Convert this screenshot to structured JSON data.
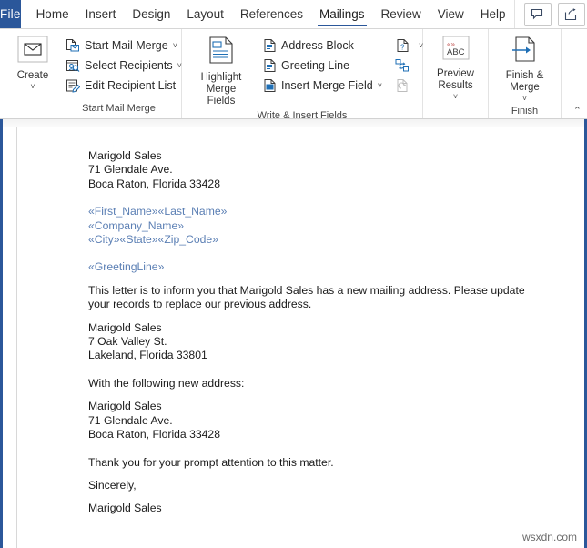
{
  "app": {
    "file_tab": "File"
  },
  "tabs": [
    {
      "label": "Home",
      "active": false
    },
    {
      "label": "Insert",
      "active": false
    },
    {
      "label": "Design",
      "active": false
    },
    {
      "label": "Layout",
      "active": false
    },
    {
      "label": "References",
      "active": false
    },
    {
      "label": "Mailings",
      "active": true
    },
    {
      "label": "Review",
      "active": false
    },
    {
      "label": "View",
      "active": false
    },
    {
      "label": "Help",
      "active": false
    }
  ],
  "titlebar_buttons": [
    {
      "name": "comments-button",
      "icon": "comment-icon"
    },
    {
      "name": "share-button",
      "icon": "share-icon"
    }
  ],
  "ribbon": {
    "groups": [
      {
        "name": "create",
        "label": "",
        "big_buttons": [
          {
            "label": "Create",
            "icon": "envelope-icon",
            "caret": "˅"
          }
        ],
        "small_buttons": []
      },
      {
        "name": "start-mail-merge",
        "label": "Start Mail Merge",
        "big_buttons": [],
        "small_buttons": [
          {
            "label": "Start Mail Merge",
            "icon": "start-mail-merge-icon",
            "caret": "˅"
          },
          {
            "label": "Select Recipients",
            "icon": "select-recipients-icon",
            "caret": "˅"
          },
          {
            "label": "Edit Recipient List",
            "icon": "edit-recipient-list-icon",
            "caret": ""
          }
        ]
      },
      {
        "name": "write-insert-fields",
        "label": "Write & Insert Fields",
        "big_buttons": [
          {
            "label": "Highlight\nMerge Fields",
            "icon": "highlight-merge-fields-icon",
            "caret": ""
          }
        ],
        "small_buttons": [
          {
            "label": "Address Block",
            "icon": "address-block-icon",
            "caret": ""
          },
          {
            "label": "Greeting Line",
            "icon": "greeting-line-icon",
            "caret": ""
          },
          {
            "label": "Insert Merge Field",
            "icon": "insert-merge-field-icon",
            "caret": "˅"
          }
        ],
        "icon_only_buttons": [
          {
            "name": "rules-button",
            "icon": "rules-icon",
            "caret": "˅"
          },
          {
            "name": "match-fields-button",
            "icon": "match-fields-icon",
            "caret": ""
          },
          {
            "name": "update-labels-button",
            "icon": "update-labels-icon",
            "caret": ""
          }
        ]
      },
      {
        "name": "preview-results",
        "label": "",
        "big_buttons": [
          {
            "label": "Preview\nResults",
            "icon": "abc-preview-icon",
            "caret": "˅"
          }
        ],
        "small_buttons": []
      },
      {
        "name": "finish",
        "label": "Finish",
        "big_buttons": [
          {
            "label": "Finish &\nMerge",
            "icon": "finish-merge-icon",
            "caret": "˅"
          }
        ],
        "small_buttons": []
      }
    ],
    "collapse_icon": "⌃"
  },
  "document": {
    "blocks": [
      {
        "type": "plain",
        "lines": [
          "Marigold Sales",
          "71 Glendale Ave.",
          "Boca Raton, Florida 33428"
        ]
      },
      {
        "type": "gap"
      },
      {
        "type": "merge",
        "lines": [
          "«First_Name»«Last_Name»",
          "«Company_Name»",
          "«City»«State»«Zip_Code»"
        ]
      },
      {
        "type": "gap"
      },
      {
        "type": "merge",
        "lines": [
          "«GreetingLine»"
        ]
      },
      {
        "type": "gap-sm"
      },
      {
        "type": "plain",
        "lines": [
          "This letter is to inform you that Marigold Sales has a new mailing address. Please update your records to replace our previous address."
        ]
      },
      {
        "type": "gap-sm"
      },
      {
        "type": "plain",
        "lines": [
          "Marigold Sales",
          "7 Oak Valley St.",
          "Lakeland, Florida 33801"
        ]
      },
      {
        "type": "gap"
      },
      {
        "type": "plain",
        "lines": [
          "With the following new address:"
        ]
      },
      {
        "type": "gap-sm"
      },
      {
        "type": "plain",
        "lines": [
          "Marigold Sales",
          "71 Glendale Ave.",
          "Boca Raton, Florida 33428"
        ]
      },
      {
        "type": "gap"
      },
      {
        "type": "plain",
        "lines": [
          "Thank you for your prompt attention to this matter."
        ]
      },
      {
        "type": "gap-sm"
      },
      {
        "type": "plain",
        "lines": [
          "Sincerely,"
        ]
      },
      {
        "type": "gap-sm"
      },
      {
        "type": "plain",
        "lines": [
          "Marigold Sales"
        ]
      }
    ]
  },
  "watermark": "wsxdn.com",
  "colors": {
    "file_tab_blue": "#2b579a",
    "accent_underline": "#2b579a",
    "merge_field": "#5b7fb4",
    "doc_border": "#2b579a"
  }
}
